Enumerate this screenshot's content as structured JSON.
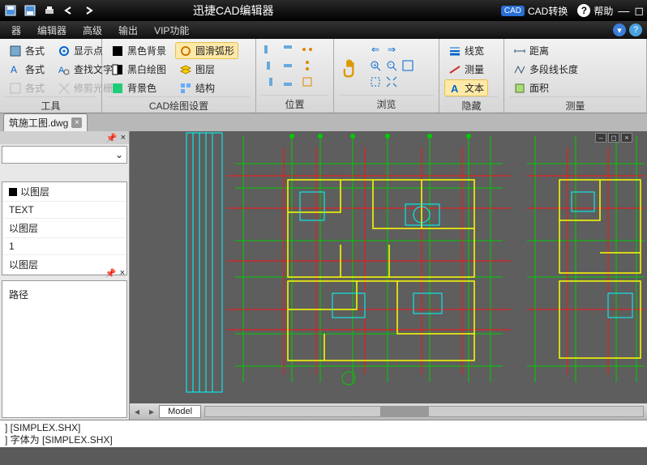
{
  "titlebar": {
    "title": "迅捷CAD编辑器",
    "badge": "CAD",
    "cad_convert": "CAD转换",
    "help": "帮助"
  },
  "menu": {
    "items": [
      "器",
      "编辑器",
      "高级",
      "输出",
      "VIP功能"
    ]
  },
  "ribbon": {
    "g1": {
      "show_point": "显示点",
      "find_text": "查找文字",
      "trim_grid": "修剪光栅",
      "fmt1": "各式",
      "fmt2": "各式",
      "fmt3": "各式",
      "label": "工具"
    },
    "g2": {
      "black_bg": "黑色背景",
      "bw_draw": "黑白绘图",
      "bg_color": "背景色",
      "smooth_arc": "圆滑弧形",
      "layer": "图层",
      "struct": "结构",
      "label": "CAD绘图设置"
    },
    "g3": {
      "label": "位置"
    },
    "g4": {
      "label": "浏览"
    },
    "g5": {
      "lineweight": "线宽",
      "measure": "测量",
      "text": "文本",
      "label": "隐藏"
    },
    "g6": {
      "distance": "距离",
      "polyline_len": "多段线长度",
      "area": "面积",
      "label": "测量"
    }
  },
  "file_tab": {
    "name": "筑施工图.dwg"
  },
  "left_panel": {
    "rows": [
      "以图层",
      "TEXT",
      "以图层",
      "1",
      "以图层"
    ],
    "path_label": "路径"
  },
  "model_tab": "Model",
  "log": {
    "line1": "] [SIMPLEX.SHX]",
    "line2": "] 字体为 [SIMPLEX.SHX]"
  }
}
